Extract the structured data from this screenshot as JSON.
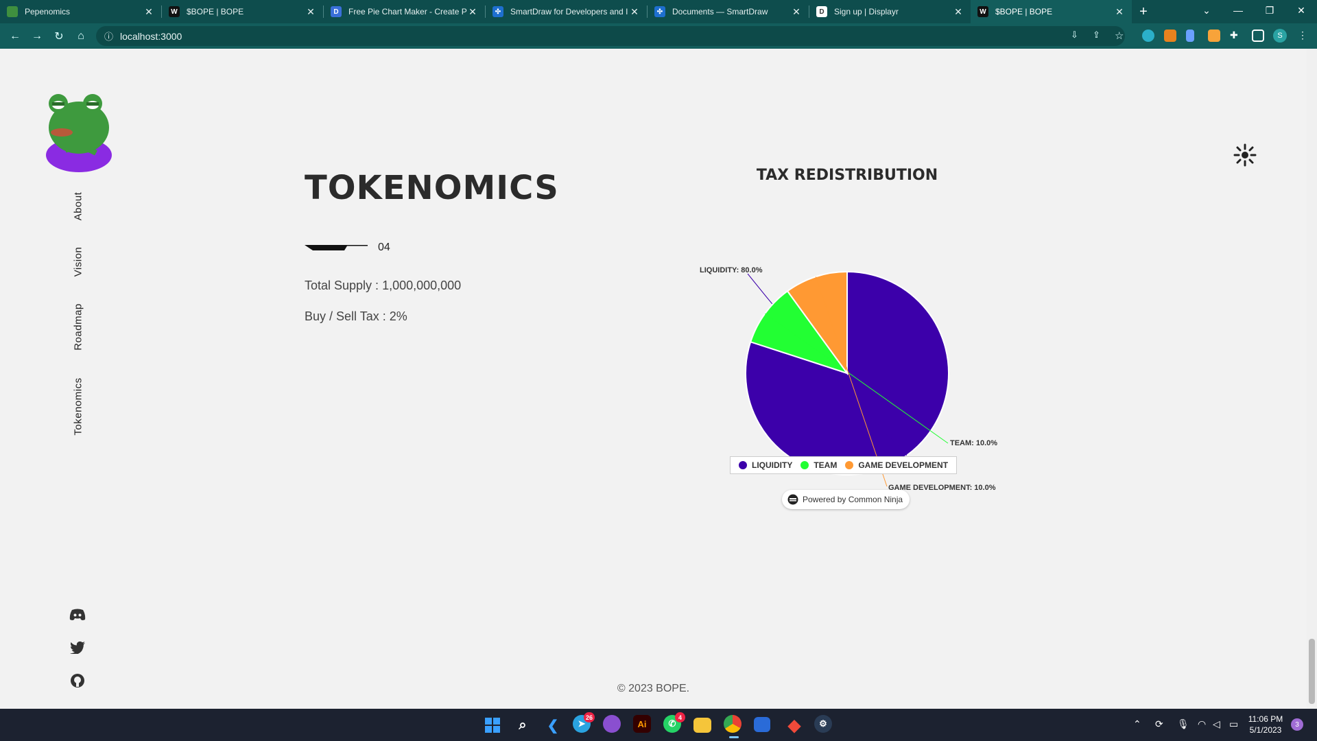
{
  "browser": {
    "tabs": [
      {
        "title": "Pepenomics",
        "favicon": "pepe-favicon",
        "favicon_color": "#3f8f3f",
        "active": false
      },
      {
        "title": "$BOPE | BOPE",
        "favicon": "w-favicon",
        "favicon_text": "W",
        "favicon_color": "#111111",
        "active": false
      },
      {
        "title": "Free Pie Chart Maker - Create Pie",
        "favicon": "d-favicon",
        "favicon_text": "D",
        "favicon_color": "#3a6fd8",
        "active": false
      },
      {
        "title": "SmartDraw for Developers and I",
        "favicon": "smartdraw-favicon",
        "favicon_text": "✣",
        "favicon_color": "#1e6fcf",
        "active": false
      },
      {
        "title": "Documents — SmartDraw",
        "favicon": "smartdraw-favicon",
        "favicon_text": "✣",
        "favicon_color": "#1e6fcf",
        "active": false
      },
      {
        "title": "Sign up | Displayr",
        "favicon": "displayr-favicon",
        "favicon_text": "D",
        "favicon_color": "#ffffff",
        "active": false
      },
      {
        "title": "$BOPE | BOPE",
        "favicon": "w-favicon",
        "favicon_text": "W",
        "favicon_color": "#111111",
        "active": true
      }
    ],
    "url": "localhost:3000",
    "profile_initial": "S"
  },
  "sidebar": {
    "nav": [
      "About",
      "Vision",
      "Roadmap",
      "Tokenomics"
    ],
    "social": [
      "discord-icon",
      "twitter-icon",
      "github-icon"
    ]
  },
  "section": {
    "heading": "TOKENOMICS",
    "number": "04",
    "total_supply": "Total Supply : 1,000,000,000",
    "tax": "Buy / Sell Tax : 2%"
  },
  "chart_data": {
    "type": "pie",
    "title": "TAX REDISTRIBUTION",
    "slices": [
      {
        "name": "LIQUIDITY",
        "value": 80.0,
        "label": "LIQUIDITY: 80.0%",
        "color": "#3c00aa"
      },
      {
        "name": "TEAM",
        "value": 10.0,
        "label": "TEAM: 10.0%",
        "color": "#22ff33"
      },
      {
        "name": "GAME DEVELOPMENT",
        "value": 10.0,
        "label": "GAME DEVELOPMENT: 10.0%",
        "color": "#ff9933"
      }
    ],
    "legend_position": "bottom"
  },
  "widget": {
    "powered_by": "Powered by Common Ninja"
  },
  "footer": {
    "copyright": "© 2023 BOPE."
  },
  "taskbar": {
    "time": "11:06 PM",
    "date": "5/1/2023",
    "telegram_badge": "26",
    "whatsapp_badge": "4",
    "notification_count": "3"
  }
}
